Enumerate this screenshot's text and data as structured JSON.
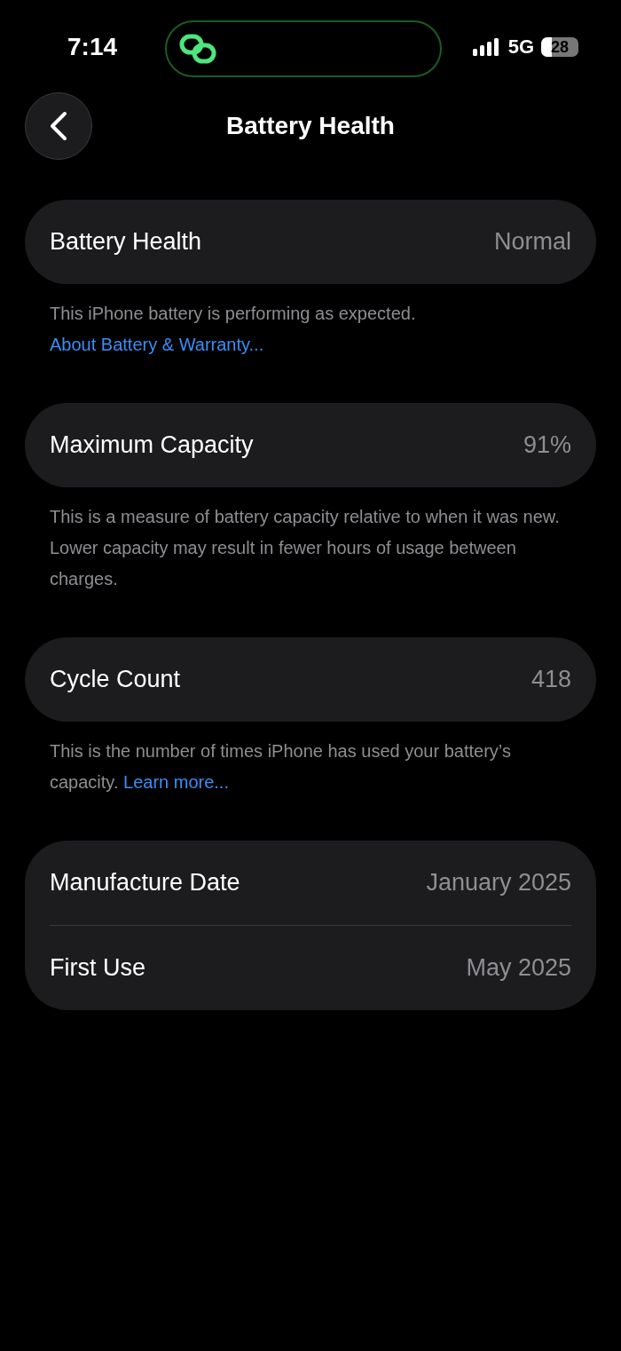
{
  "status_bar": {
    "time": "7:14",
    "network": "5G",
    "battery": "28"
  },
  "nav": {
    "title": "Battery Health"
  },
  "groups": [
    {
      "rows": [
        {
          "label": "Battery Health",
          "value": "Normal"
        }
      ],
      "footer": {
        "text": "This iPhone battery is performing as expected.",
        "link": "About Battery & Warranty..."
      }
    },
    {
      "rows": [
        {
          "label": "Maximum Capacity",
          "value": "91%"
        }
      ],
      "footer": {
        "text": "This is a measure of battery capacity relative to when it was new. Lower capacity may result in fewer hours of usage between charges."
      }
    },
    {
      "rows": [
        {
          "label": "Cycle Count",
          "value": "418"
        }
      ],
      "footer": {
        "text": "This is the number of times iPhone has used your battery’s capacity.",
        "link": "Learn more..."
      }
    },
    {
      "rows": [
        {
          "label": "Manufacture Date",
          "value": "January 2025"
        },
        {
          "label": "First Use",
          "value": "May 2025"
        }
      ]
    }
  ]
}
